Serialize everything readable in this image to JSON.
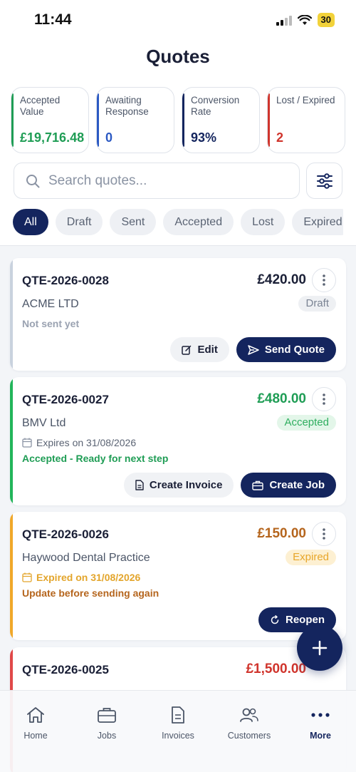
{
  "status_bar": {
    "time": "11:44",
    "battery": "30"
  },
  "page": {
    "title": "Quotes"
  },
  "stats": [
    {
      "label": "Accepted Value",
      "value": "£19,716.48",
      "color": "#1f9d55"
    },
    {
      "label": "Awaiting Response",
      "value": "0",
      "color": "#2b59c3"
    },
    {
      "label": "Conversion Rate",
      "value": "93%",
      "color": "#14255e"
    },
    {
      "label": "Lost / Expired",
      "value": "2",
      "color": "#d0342c"
    }
  ],
  "search": {
    "placeholder": "Search quotes..."
  },
  "filters": [
    "All",
    "Draft",
    "Sent",
    "Accepted",
    "Lost",
    "Expired"
  ],
  "active_filter": "All",
  "quotes": [
    {
      "number": "QTE-2026-0028",
      "amount": "£420.00",
      "customer": "ACME LTD",
      "status": "Draft",
      "line1": "Not sent yet",
      "actions": [
        "Edit",
        "Send Quote"
      ],
      "accent": "#c9d2de"
    },
    {
      "number": "QTE-2026-0027",
      "amount": "£480.00",
      "customer": "BMV Ltd",
      "status": "Accepted",
      "line1": "Expires on 31/08/2026",
      "line2": "Accepted - Ready for next step",
      "actions": [
        "Create Invoice",
        "Create Job"
      ],
      "accent": "#22b55a"
    },
    {
      "number": "QTE-2026-0026",
      "amount": "£150.00",
      "customer": "Haywood Dental Practice",
      "status": "Expired",
      "line1": "Expired on 31/08/2026",
      "line2": "Update before sending again",
      "actions": [
        "Reopen"
      ],
      "accent": "#f0a82a"
    },
    {
      "number": "QTE-2026-0025",
      "amount": "£1,500.00",
      "accent": "#e04848"
    }
  ],
  "nav": [
    {
      "label": "Home",
      "icon": "home-icon"
    },
    {
      "label": "Jobs",
      "icon": "briefcase-icon"
    },
    {
      "label": "Invoices",
      "icon": "document-icon"
    },
    {
      "label": "Customers",
      "icon": "users-icon"
    },
    {
      "label": "More",
      "icon": "dots-icon"
    }
  ]
}
